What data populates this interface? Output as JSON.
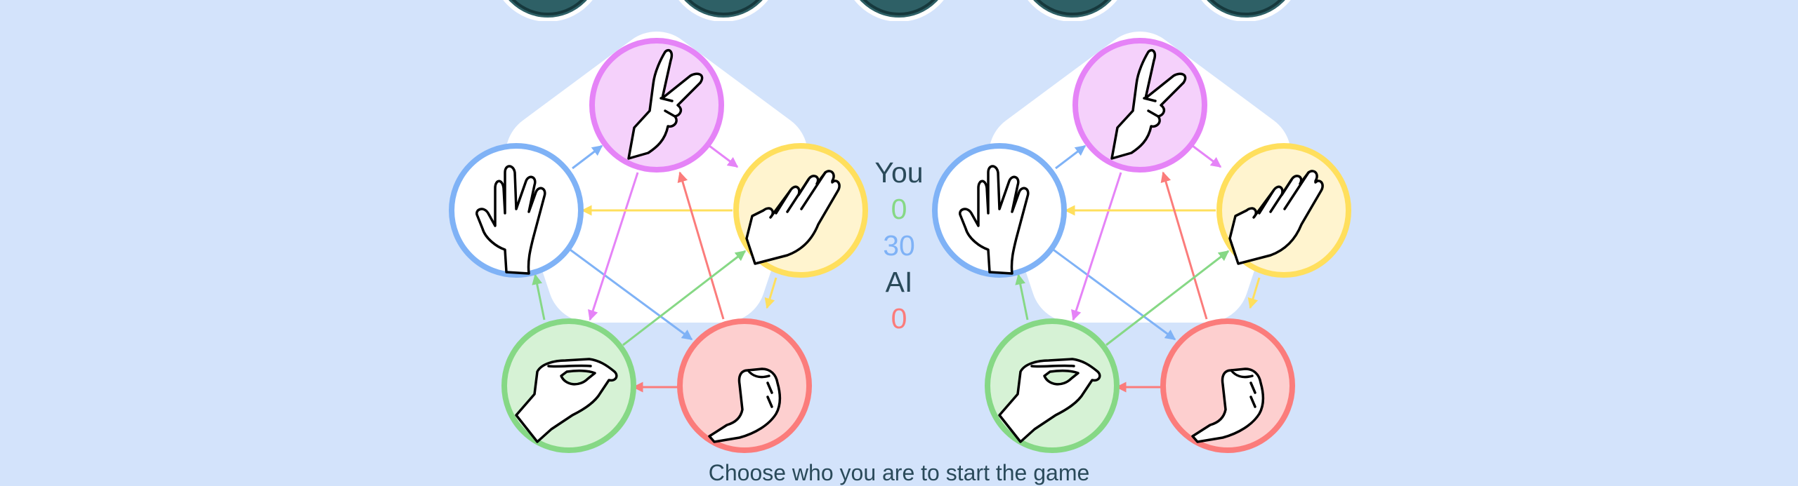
{
  "scoreboard": {
    "you_label": "You",
    "you_score": "0",
    "draws": "30",
    "ai_label": "AI",
    "ai_score": "0"
  },
  "message": "Choose who you are to start the game",
  "colors": {
    "background": "#d3e3fb",
    "scissors": "#e583f7",
    "paper": "#ffdf5d",
    "rock": "#fb7c7b",
    "lizard": "#86d885",
    "spock": "#7fb2f6",
    "dark": "#2a4a5a"
  },
  "icons": [
    "scissors-hand-icon",
    "paper-hand-icon",
    "rock-fist-icon",
    "lizard-hand-icon",
    "spock-hand-icon"
  ]
}
